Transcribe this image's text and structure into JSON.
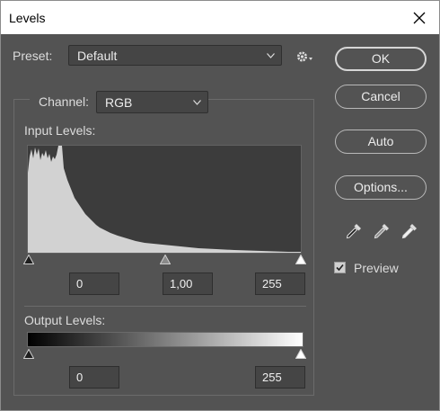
{
  "window": {
    "title": "Levels"
  },
  "preset": {
    "label": "Preset:",
    "value": "Default"
  },
  "channel": {
    "label": "Channel:",
    "value": "RGB"
  },
  "input_levels": {
    "label": "Input Levels:",
    "black": "0",
    "gamma": "1,00",
    "white": "255"
  },
  "output_levels": {
    "label": "Output Levels:",
    "black": "0",
    "white": "255"
  },
  "buttons": {
    "ok": "OK",
    "cancel": "Cancel",
    "auto": "Auto",
    "options": "Options..."
  },
  "preview": {
    "label": "Preview",
    "checked": true
  },
  "icons": {
    "close": "close-icon",
    "gear": "gear-icon",
    "dropdown": "chevron-down-icon",
    "eyedroppers": [
      "black-point-eyedropper-icon",
      "gray-point-eyedropper-icon",
      "white-point-eyedropper-icon"
    ]
  },
  "colors": {
    "background": "#535353",
    "histogram_fill": "#d2d2d2",
    "histogram_bg": "#3c3c3c"
  }
}
